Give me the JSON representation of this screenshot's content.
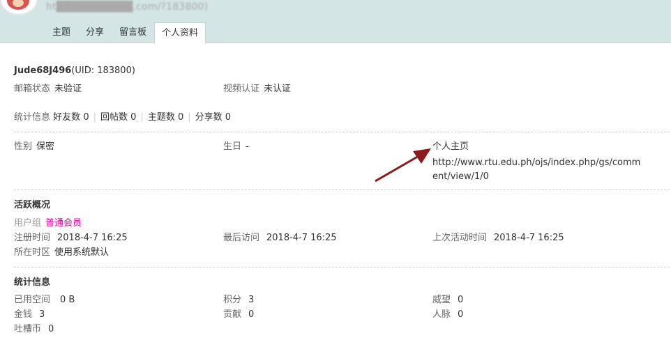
{
  "header": {
    "url_text": "ht██████████.com/?183800)",
    "tabs": [
      "主题",
      "分享",
      "留言板",
      "个人资料"
    ],
    "active_tab": "个人资料",
    "colors": {
      "header_bg": "#d3e5e5"
    }
  },
  "profile": {
    "username": "Jude68J496",
    "uid_text": "(UID: 183800)",
    "email_status_label": "邮箱状态",
    "email_status_value": "未验证",
    "video_auth_label": "视频认证",
    "video_auth_value": "未认证",
    "stats_label": "统计信息",
    "stats": [
      {
        "label": "好友数",
        "value": "0"
      },
      {
        "label": "回帖数",
        "value": "0"
      },
      {
        "label": "主题数",
        "value": "0"
      },
      {
        "label": "分享数",
        "value": "0"
      }
    ],
    "gender_label": "性别",
    "gender_value": "保密",
    "birthday_label": "生日",
    "birthday_value": "-",
    "homepage_label": "个人主页",
    "homepage_url": "http://www.rtu.edu.ph/ojs/index.php/gs/comment/view/1/0"
  },
  "activity": {
    "title": "活跃概况",
    "usergroup_label": "用户组",
    "usergroup_value": "普通会员",
    "register_label": "注册时间",
    "register_value": "2018-4-7 16:25",
    "last_visit_label": "最后访问",
    "last_visit_value": "2018-4-7 16:25",
    "last_active_label": "上次活动时间",
    "last_active_value": "2018-4-7 16:25",
    "timezone_label": "所在时区",
    "timezone_value": "使用系统默认"
  },
  "statistics": {
    "title": "统计信息",
    "space_label": "已用空间",
    "space_value": "0 B",
    "credits_label": "积分",
    "credits_value": "3",
    "prestige_label": "威望",
    "prestige_value": "0",
    "money_label": "金钱",
    "money_value": "3",
    "contribution_label": "贡献",
    "contribution_value": "0",
    "connections_label": "人脉",
    "connections_value": "0",
    "tucao_label": "吐槽币",
    "tucao_value": "0"
  },
  "colors": {
    "usergroup": "#e100a0",
    "arrow": "#8b1a1a"
  }
}
